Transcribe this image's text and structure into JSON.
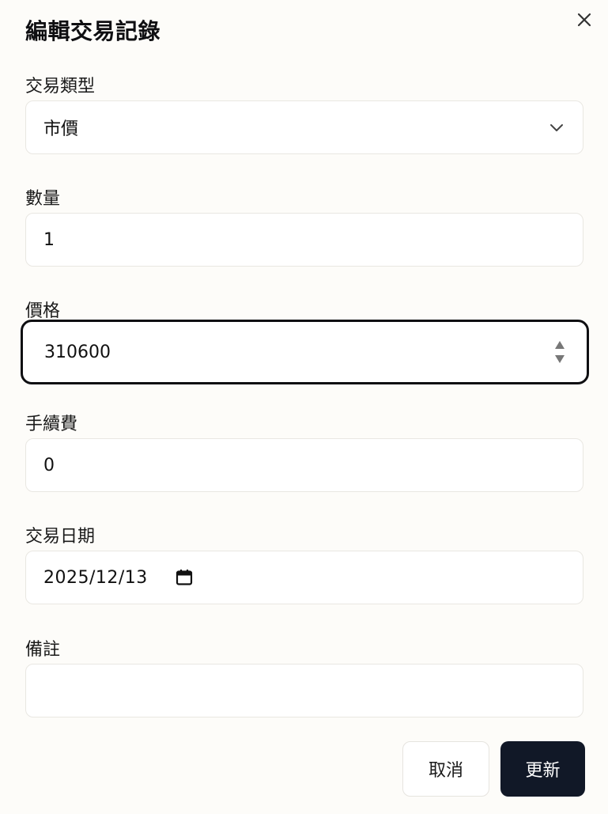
{
  "dialog": {
    "title": "編輯交易記錄",
    "close_icon": "close-icon"
  },
  "fields": {
    "type": {
      "label": "交易類型",
      "value": "市價",
      "icon": "chevron-down-icon"
    },
    "quantity": {
      "label": "數量",
      "value": "1"
    },
    "price": {
      "label": "價格",
      "value": "310600",
      "icon": "spinner-icon",
      "focused": true
    },
    "fee": {
      "label": "手續費",
      "value": "0"
    },
    "date": {
      "label": "交易日期",
      "value": "2025/12/13",
      "icon": "calendar-icon"
    },
    "note": {
      "label": "備註",
      "value": ""
    }
  },
  "actions": {
    "cancel_label": "取消",
    "update_label": "更新"
  },
  "colors": {
    "background": "#fdfcf9",
    "primary_button": "#111827",
    "focus_border": "#0f0f12",
    "field_border": "#e9e7e2"
  }
}
